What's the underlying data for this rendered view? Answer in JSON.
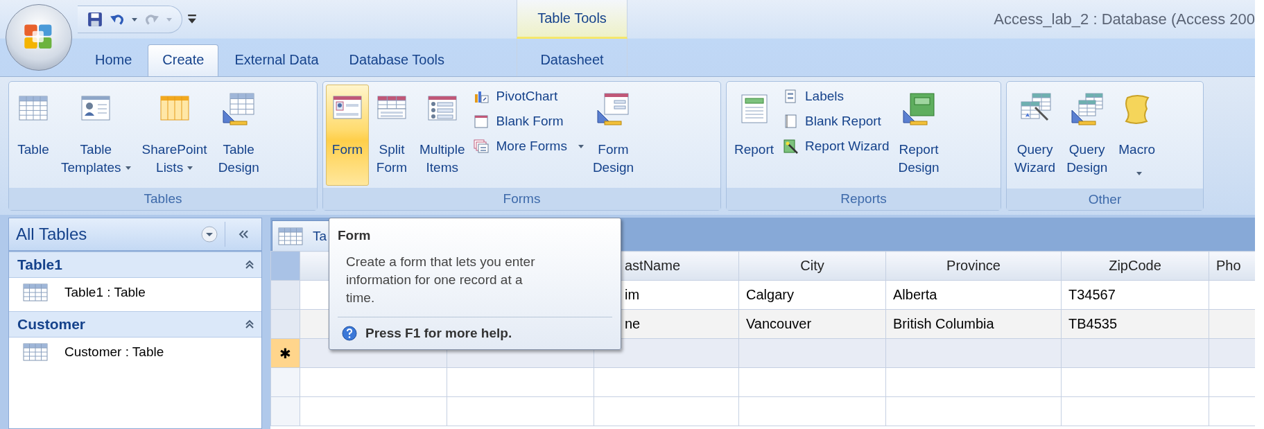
{
  "window": {
    "title": "Access_lab_2 : Database (Access 200"
  },
  "ribbon_tabs": [
    {
      "label": "Home",
      "selected": false
    },
    {
      "label": "Create",
      "selected": true
    },
    {
      "label": "External Data",
      "selected": false
    },
    {
      "label": "Database Tools",
      "selected": false
    }
  ],
  "context_tabs": {
    "label": "Table Tools",
    "tabs": [
      {
        "label": "Datasheet",
        "selected": false
      }
    ]
  },
  "ribbon_groups": [
    {
      "label": "Tables",
      "items": [
        {
          "kind": "large",
          "label": "Table",
          "dropdown": false,
          "selected": false
        },
        {
          "kind": "large",
          "label": "Table\nTemplates",
          "dropdown": true,
          "selected": false
        },
        {
          "kind": "large",
          "label": "SharePoint\nLists",
          "dropdown": true,
          "selected": false
        },
        {
          "kind": "large",
          "label": "Table\nDesign",
          "dropdown": false,
          "selected": false
        }
      ]
    },
    {
      "label": "Forms",
      "items": [
        {
          "kind": "large",
          "label": "Form",
          "dropdown": false,
          "selected": true
        },
        {
          "kind": "large",
          "label": "Split\nForm",
          "dropdown": false,
          "selected": false
        },
        {
          "kind": "large",
          "label": "Multiple\nItems",
          "dropdown": false,
          "selected": false
        },
        {
          "kind": "stack",
          "items": [
            {
              "label": "PivotChart",
              "dropdown": false
            },
            {
              "label": "Blank Form",
              "dropdown": false
            },
            {
              "label": "More Forms",
              "dropdown": true
            }
          ]
        },
        {
          "kind": "large",
          "label": "Form\nDesign",
          "dropdown": false,
          "selected": false
        }
      ]
    },
    {
      "label": "Reports",
      "items": [
        {
          "kind": "large",
          "label": "Report",
          "dropdown": false,
          "selected": false
        },
        {
          "kind": "stack",
          "items": [
            {
              "label": "Labels",
              "dropdown": false
            },
            {
              "label": "Blank Report",
              "dropdown": false
            },
            {
              "label": "Report Wizard",
              "dropdown": false
            }
          ]
        },
        {
          "kind": "large",
          "label": "Report\nDesign",
          "dropdown": false,
          "selected": false
        }
      ]
    },
    {
      "label": "Other",
      "items": [
        {
          "kind": "large",
          "label": "Query\nWizard",
          "dropdown": false,
          "selected": false
        },
        {
          "kind": "large",
          "label": "Query\nDesign",
          "dropdown": false,
          "selected": false
        },
        {
          "kind": "large",
          "label": "Macro",
          "dropdown": true,
          "selected": false
        }
      ]
    }
  ],
  "navigation": {
    "title": "All Tables",
    "groups": [
      {
        "label": "Table1",
        "expanded": true,
        "items": [
          {
            "label": "Table1 : Table"
          }
        ]
      },
      {
        "label": "Customer",
        "expanded": true,
        "items": [
          {
            "label": "Customer : Table"
          }
        ]
      }
    ]
  },
  "document": {
    "tabs": [
      {
        "label": "Ta",
        "selected": true
      }
    ],
    "table": {
      "columns": [
        {
          "label": "astName"
        },
        {
          "label": "City"
        },
        {
          "label": "Province"
        },
        {
          "label": "ZipCode"
        },
        {
          "label": "Pho"
        }
      ],
      "rows": [
        {
          "cells": [
            "im",
            "Calgary",
            "Alberta",
            "T34567"
          ],
          "selected": false
        },
        {
          "cells": [
            "ne",
            "Vancouver",
            "British Columbia",
            "TB4535"
          ],
          "selected": false
        }
      ],
      "new_row": {
        "marker": "✱",
        "selected": true
      }
    }
  },
  "tooltip": {
    "title": "Form",
    "description": "Create a form that lets you enter information for one record at a time.",
    "help": "Press F1 for more help."
  }
}
